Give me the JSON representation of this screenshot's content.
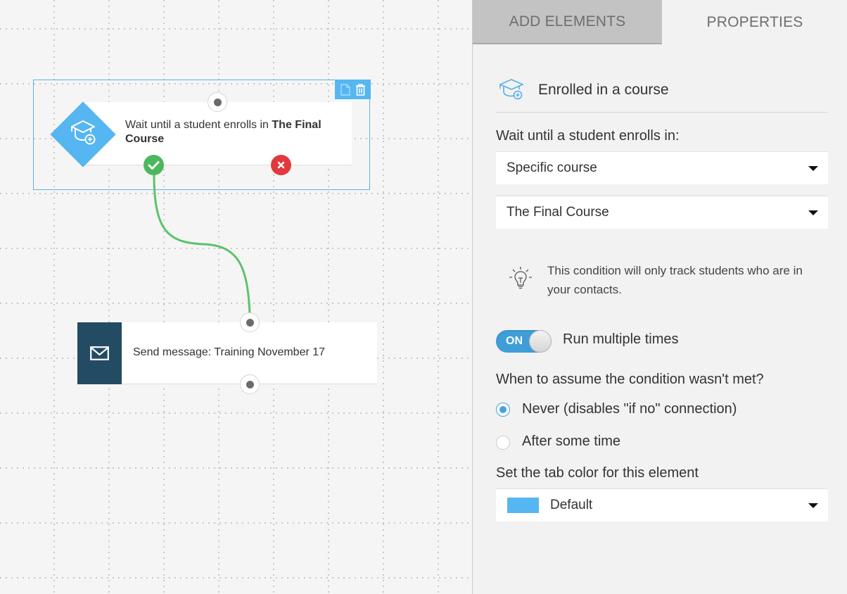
{
  "canvas": {
    "condition_node": {
      "text_prefix": "Wait until a student enrolls in ",
      "text_bold": "The Final Course",
      "icon": "graduation-cap-plus-icon",
      "color": "#56b6f2",
      "toolbar": {
        "duplicate_icon": "document-icon",
        "delete_icon": "trash-icon"
      },
      "yes_icon": "check-icon",
      "no_icon": "x-icon"
    },
    "message_node": {
      "text": "Send message: Training November 17",
      "icon": "envelope-icon",
      "color": "#234b63"
    },
    "connection_color": "#5cc36a"
  },
  "panel": {
    "tabs": [
      {
        "label": "ADD ELEMENTS",
        "active": false
      },
      {
        "label": "PROPERTIES",
        "active": true
      }
    ],
    "header": {
      "icon": "graduation-cap-plus-icon",
      "title": "Enrolled in a course"
    },
    "wait_label": "Wait until a student enrolls in:",
    "course_type_select": {
      "value": "Specific course"
    },
    "course_select": {
      "value": "The Final Course"
    },
    "tip": {
      "icon": "lightbulb-icon",
      "text": "This condition will only track students who are in your contacts."
    },
    "run_multiple": {
      "toggle_label": "ON",
      "state": true,
      "label": "Run multiple times"
    },
    "assume_label": "When to assume the condition wasn't met?",
    "assume_options": [
      {
        "label": "Never (disables \"if no\" connection)",
        "checked": true
      },
      {
        "label": "After some time",
        "checked": false
      }
    ],
    "tab_color_label": "Set the tab color for this element",
    "tab_color_select": {
      "value": "Default",
      "swatch": "#56b6f2"
    }
  }
}
